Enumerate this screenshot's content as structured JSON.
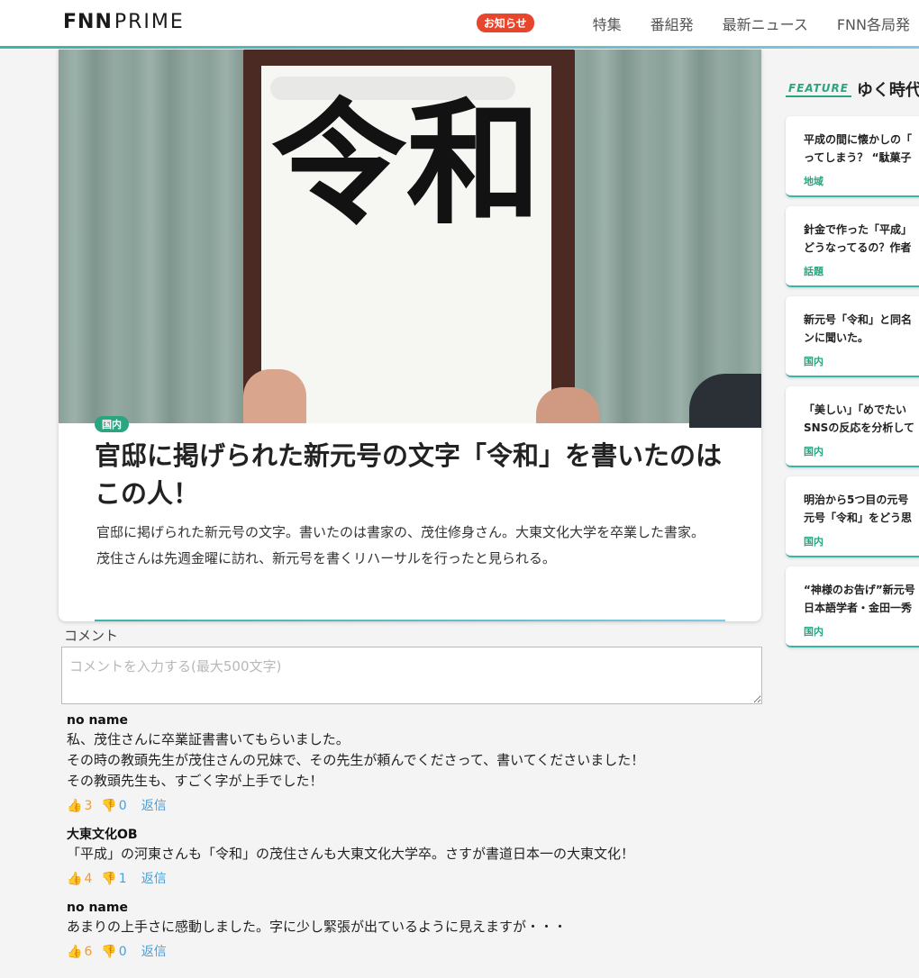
{
  "header": {
    "logo_fnn": "FNN",
    "logo_prime": "PRIME",
    "notice_badge": "お知らせ",
    "nav": [
      "特集",
      "番組発",
      "最新ニュース",
      "FNN各局発"
    ]
  },
  "article": {
    "hero_text": "令和",
    "category": "国内",
    "title": "官邸に掲げられた新元号の文字「令和」を書いたのはこの人！",
    "body": [
      "官邸に掲げられた新元号の文字。書いたのは書家の、茂住修身さん。大東文化大学を卒業した書家。",
      "茂住さんは先週金曜に訪れ、新元号を書くリハーサルを行ったと見られる。"
    ]
  },
  "comments_section": {
    "label": "コメント",
    "placeholder": "コメントを入力する(最大500文字)",
    "reply_label": "返信",
    "items": [
      {
        "author": "no name",
        "text": "私、茂住さんに卒業証書書いてもらいました。\nその時の教頭先生が茂住さんの兄妹で、その先生が頼んでくださって、書いてくださいました！\nその教頭先生も、すごく字が上手でした！",
        "likes": "3",
        "dislikes": "0"
      },
      {
        "author": "大東文化OB",
        "text": "「平成」の河東さんも「令和」の茂住さんも大東文化大学卒。さすが書道日本一の大東文化！",
        "likes": "4",
        "dislikes": "1"
      },
      {
        "author": "no name",
        "text": "あまりの上手さに感動しました。字に少し緊張が出ているように見えますが・・・",
        "likes": "6",
        "dislikes": "0"
      }
    ]
  },
  "sidebar": {
    "feature_badge": "FEATURE",
    "feature_title": "ゆく時代",
    "items": [
      {
        "title": "平成の間に懐かしの「\nってしまう？ “駄菓子",
        "category": "地域"
      },
      {
        "title": "針金で作った「平成」\nどうなってるの？作者",
        "category": "話題"
      },
      {
        "title": "新元号「令和」と同名\nンに聞いた。",
        "category": "国内"
      },
      {
        "title": "「美しい」「めでたい\nSNSの反応を分析して",
        "category": "国内"
      },
      {
        "title": "明治から5つ目の元号\n元号「令和」をどう思",
        "category": "国内"
      },
      {
        "title": "“神様のお告げ”新元号\n日本語学者・金田一秀",
        "category": "国内"
      }
    ]
  },
  "colors": {
    "accent": "#2aa57f",
    "notice": "#e8462c",
    "like": "#f29a2e",
    "link": "#4a9fd8"
  }
}
